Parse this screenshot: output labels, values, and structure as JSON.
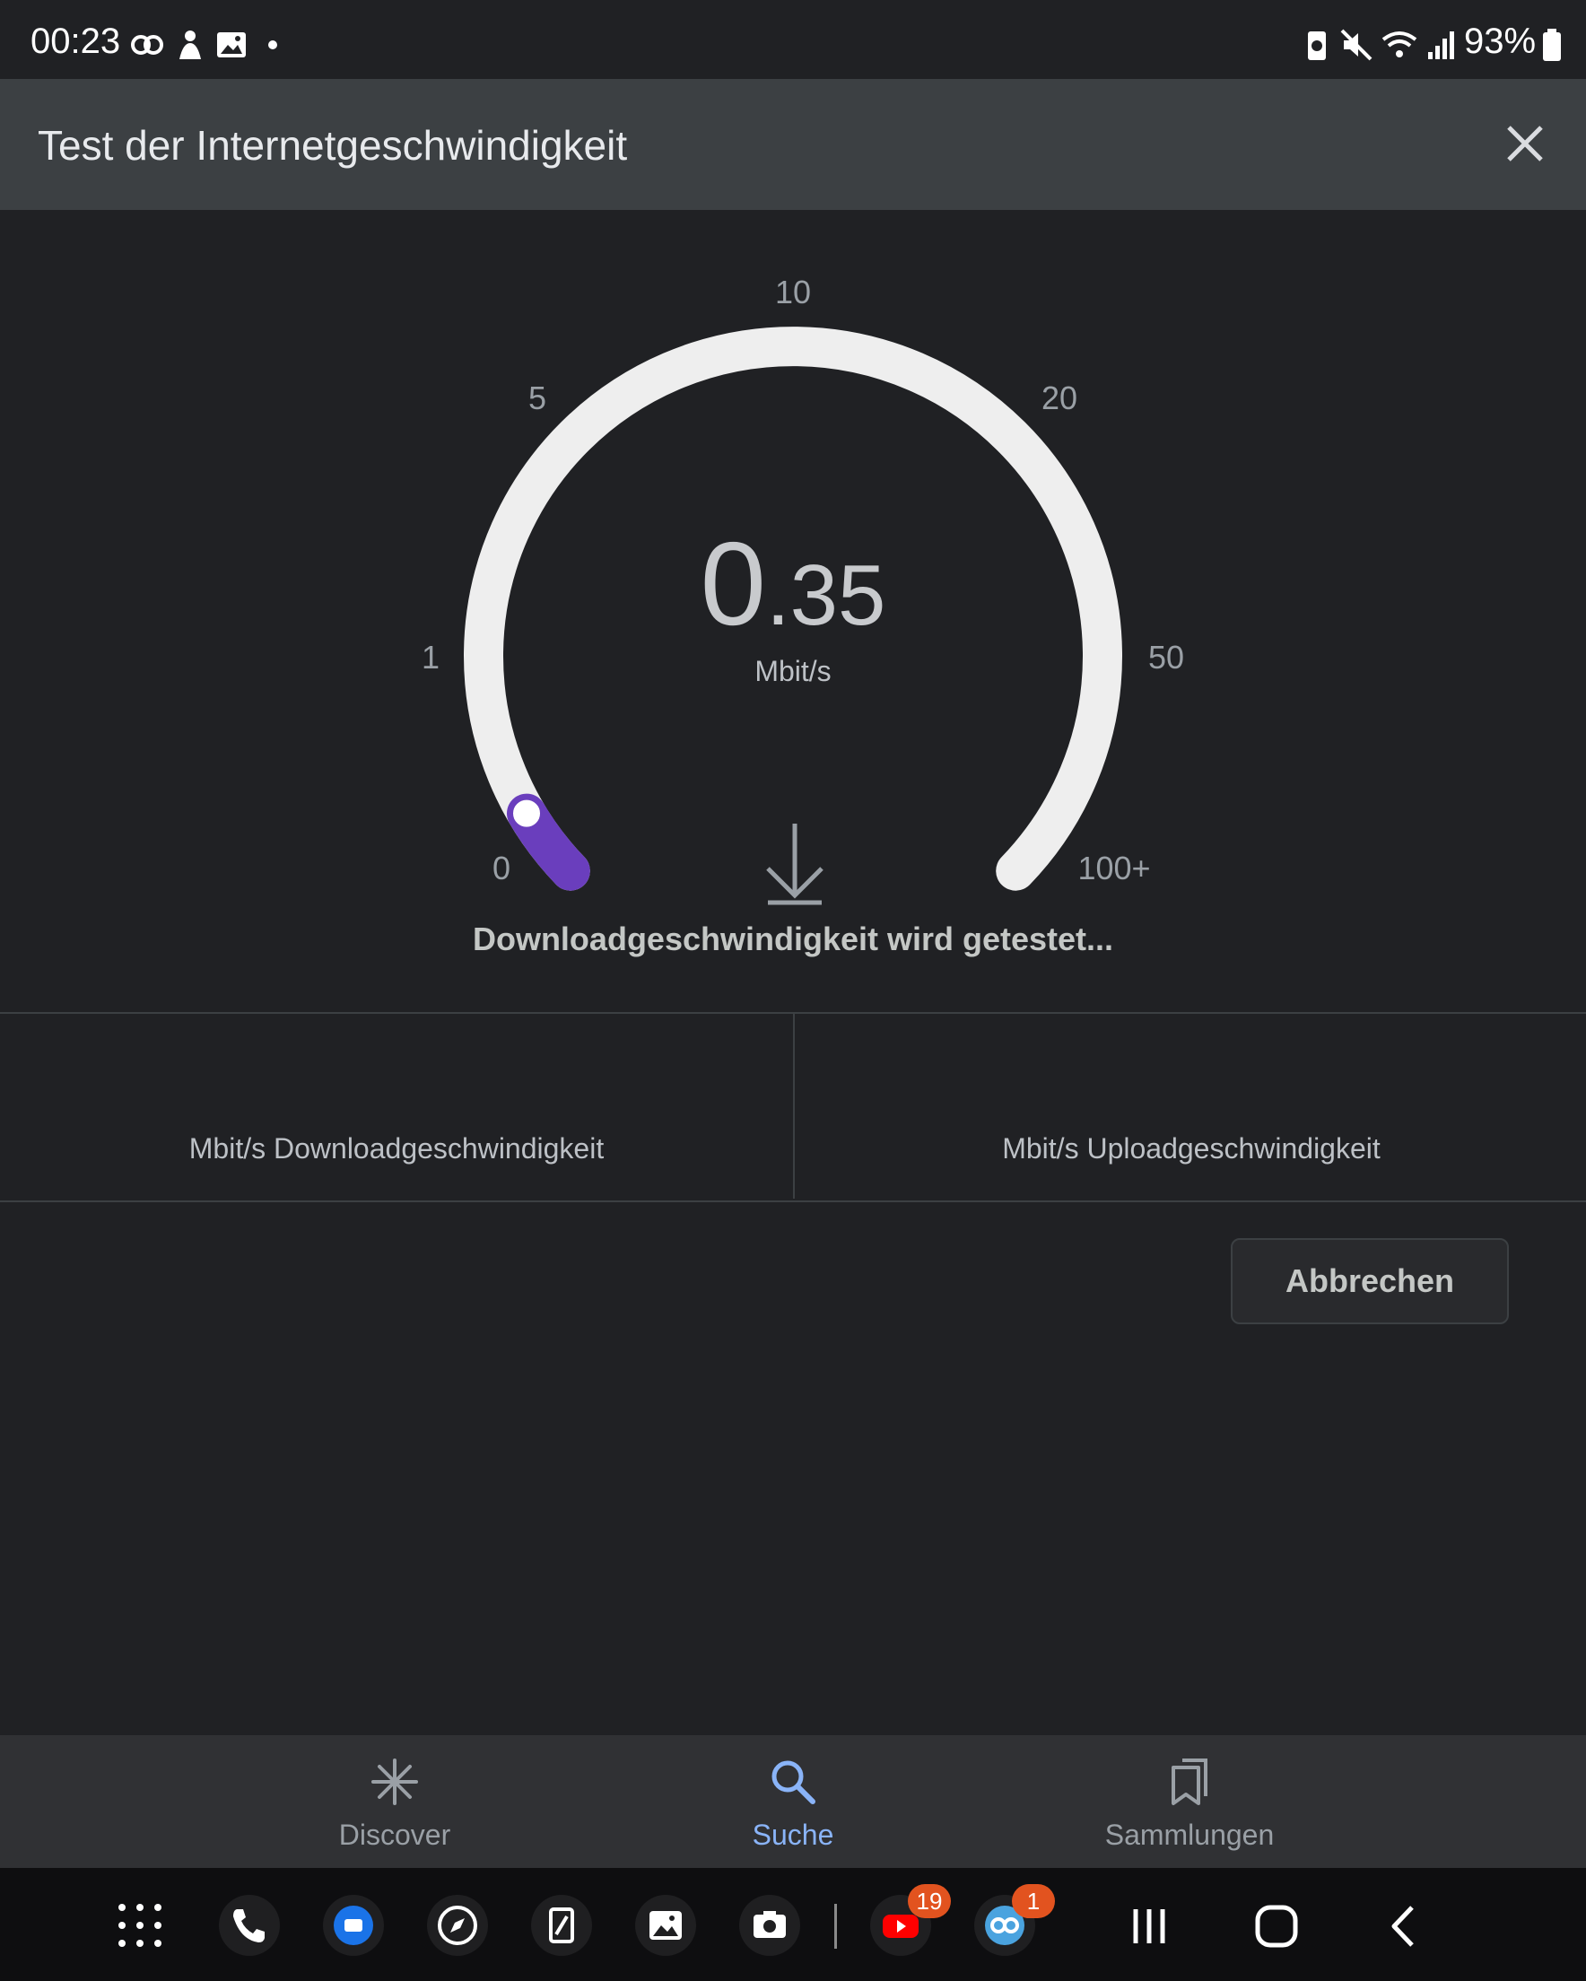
{
  "status_bar": {
    "time": "00:23",
    "battery": "93%"
  },
  "header": {
    "title": "Test der Internetgeschwindigkeit",
    "close_icon": "close-icon"
  },
  "gauge": {
    "ticks": [
      "0",
      "1",
      "5",
      "10",
      "20",
      "50",
      "100+"
    ],
    "value_int": "0",
    "value_dec": ".35",
    "unit": "Mbit/s",
    "status": "Downloadgeschwindigkeit wird getestet...",
    "progress_fraction": 0.05,
    "colors": {
      "track": "#eeeeee",
      "progress": "#6a3ebd",
      "background": "#202124"
    }
  },
  "results": {
    "download_label": "Mbit/s Downloadgeschwindigkeit",
    "upload_label": "Mbit/s Uploadgeschwindigkeit"
  },
  "actions": {
    "cancel": "Abbrechen"
  },
  "bottom_nav": {
    "items": [
      {
        "label": "Discover",
        "icon": "asterisk-icon"
      },
      {
        "label": "Suche",
        "icon": "search-icon",
        "active": true
      },
      {
        "label": "Sammlungen",
        "icon": "bookmarks-icon"
      }
    ]
  },
  "dock": {
    "youtube_badge": "19",
    "messenger_badge": "1"
  }
}
